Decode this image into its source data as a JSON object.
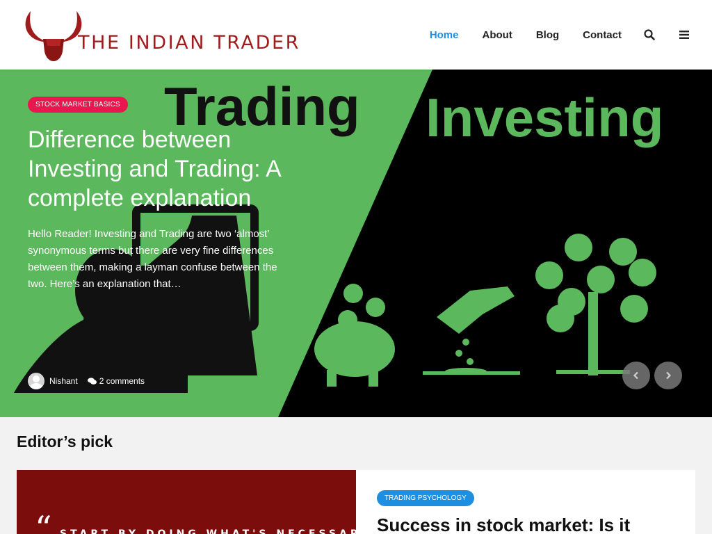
{
  "site": {
    "logo_text": "THE INDIAN TRADER",
    "brand_color": "#9e1c1c"
  },
  "nav": {
    "items": [
      {
        "label": "Home",
        "active": true
      },
      {
        "label": "About",
        "active": false
      },
      {
        "label": "Blog",
        "active": false
      },
      {
        "label": "Contact",
        "active": false
      }
    ],
    "search_icon": "search-icon",
    "menu_icon": "hamburger-menu-icon",
    "active_color": "#1d8ee0"
  },
  "hero": {
    "category": "Stock Market Basics",
    "title": "Difference between Investing and Trading: A complete explanation",
    "excerpt": "Hello Reader! Investing and Trading are two ‘almost’ synonymous terms but there are very fine differences between them, making a layman confuse between the two. Here’s an explanation that…",
    "author": "Nishant",
    "comments": "2 comments",
    "image_labels": {
      "left": "Trading",
      "right": "Investing"
    },
    "badge_color": "#e8184f",
    "art_green": "#5cb85c"
  },
  "editors_pick": {
    "heading": "Editor’s pick",
    "card": {
      "quote_mark": "“",
      "quote_text": "START BY DOING WHAT'S NECESSARY",
      "category": "Trading Psychology",
      "title": "Success in stock market: Is it"
    }
  }
}
